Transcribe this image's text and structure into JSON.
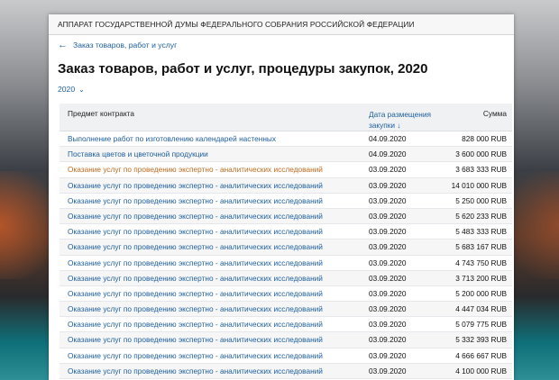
{
  "org": "АППАРАТ ГОСУДАРСТВЕННОЙ ДУМЫ ФЕДЕРАЛЬНОГО СОБРАНИЯ РОССИЙСКОЙ ФЕДЕРАЦИИ",
  "breadcrumb": {
    "label": "Заказ товаров, работ и услуг"
  },
  "page_title": "Заказ товаров, работ и услуг, процедуры закупок, 2020",
  "year_select": {
    "value": "2020"
  },
  "table": {
    "headers": {
      "subject": "Предмет контракта",
      "date": "Дата размещения",
      "date_sort": "закупки",
      "sum": "Сумма"
    },
    "rows": [
      {
        "subject": "Выполнение работ по изготовлению календарей настенных",
        "date": "04.09.2020",
        "sum": "828 000 RUB"
      },
      {
        "subject": "Поставка цветов и цветочной продукции",
        "date": "04.09.2020",
        "sum": "3 600 000 RUB"
      },
      {
        "subject": "Оказание услуг по проведению экспертно - аналитических исследований",
        "date": "03.09.2020",
        "sum": "3 683 333 RUB"
      },
      {
        "subject": "Оказание услуг по проведению экспертно - аналитических исследований",
        "date": "03.09.2020",
        "sum": "14 010 000 RUB"
      },
      {
        "subject": "Оказание услуг по проведению экспертно - аналитических исследований",
        "date": "03.09.2020",
        "sum": "5 250 000 RUB"
      },
      {
        "subject": "Оказание услуг по проведению экспертно - аналитических исследований",
        "date": "03.09.2020",
        "sum": "5 620 233 RUB"
      },
      {
        "subject": "Оказание услуг по проведению экспертно - аналитических исследований",
        "date": "03.09.2020",
        "sum": "5 483 333 RUB"
      },
      {
        "subject": "Оказание услуг по проведению экспертно - аналитических исследований",
        "date": "03.09.2020",
        "sum": "5 683 167 RUB"
      },
      {
        "subject": "Оказание услуг по проведению экспертно - аналитических исследований",
        "date": "03.09.2020",
        "sum": "4 743 750 RUB"
      },
      {
        "subject": "Оказание услуг по проведению экспертно - аналитических исследований",
        "date": "03.09.2020",
        "sum": "3 713 200 RUB"
      },
      {
        "subject": "Оказание услуг по проведению экспертно - аналитических исследований",
        "date": "03.09.2020",
        "sum": "5 200 000 RUB"
      },
      {
        "subject": "Оказание услуг по проведению экспертно - аналитических исследований",
        "date": "03.09.2020",
        "sum": "4 447 034 RUB"
      },
      {
        "subject": "Оказание услуг по проведению экспертно - аналитических исследований",
        "date": "03.09.2020",
        "sum": "5 079 775 RUB"
      },
      {
        "subject": "Оказание услуг по проведению экспертно - аналитических исследований",
        "date": "03.09.2020",
        "sum": "5 332 393 RUB"
      },
      {
        "subject": "Оказание услуг по проведению экспертно - аналитических исследований",
        "date": "03.09.2020",
        "sum": "4 666 667 RUB"
      },
      {
        "subject": "Оказание услуг по проведению экспертно - аналитических исследований",
        "date": "03.09.2020",
        "sum": "4 100 000 RUB"
      }
    ]
  },
  "colors": {
    "link": "#1d5e9e",
    "hover_link": "#c06a1f"
  },
  "icons": {
    "back": "arrow-left-icon",
    "year": "chevron-down-icon",
    "sort": "arrow-down-icon"
  }
}
